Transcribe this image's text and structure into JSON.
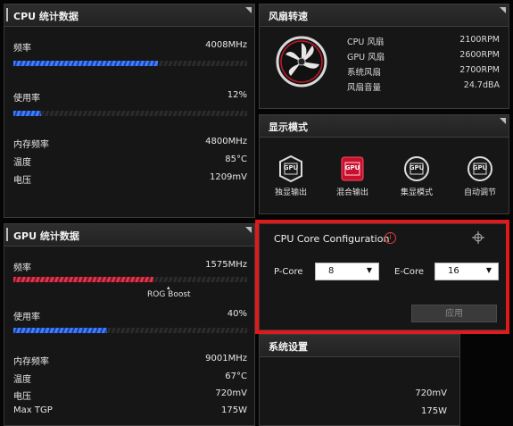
{
  "cpu_stats": {
    "title": "CPU 统计数据",
    "freq_label": "频率",
    "freq_value": "4008MHz",
    "freq_fill": 0.62,
    "usage_label": "使用率",
    "usage_value": "12%",
    "usage_fill": 0.12,
    "mem_freq_label": "内存频率",
    "mem_freq_value": "4800MHz",
    "temp_label": "温度",
    "temp_value": "85°C",
    "voltage_label": "电压",
    "voltage_value": "1209mV"
  },
  "gpu_stats": {
    "title": "GPU 统计数据",
    "freq_label": "频率",
    "freq_value": "1575MHz",
    "freq_fill": 0.6,
    "boost_label": "ROG Boost",
    "usage_label": "使用率",
    "usage_value": "40%",
    "usage_fill": 0.4,
    "mem_freq_label": "内存频率",
    "mem_freq_value": "9001MHz",
    "temp_label": "温度",
    "temp_value": "67°C",
    "voltage_label": "电压",
    "voltage_value": "720mV",
    "tgp_label": "Max TGP",
    "tgp_value": "175W"
  },
  "fan": {
    "title": "风扇转速",
    "rows": [
      {
        "label": "CPU 风扇",
        "value": "2100RPM"
      },
      {
        "label": "GPU 风扇",
        "value": "2600RPM"
      },
      {
        "label": "系统风扇",
        "value": "2700RPM"
      },
      {
        "label": "风扇音量",
        "value": "24.7dBA"
      }
    ]
  },
  "display_mode": {
    "title": "显示模式",
    "icon_text": "GPU",
    "modes": [
      {
        "label": "独显输出",
        "icon": "gpu-dedicated-icon",
        "active": false
      },
      {
        "label": "混合输出",
        "icon": "gpu-hybrid-icon",
        "active": true
      },
      {
        "label": "集显模式",
        "icon": "gpu-integrated-icon",
        "active": false
      },
      {
        "label": "自动调节",
        "icon": "gpu-auto-icon",
        "active": false
      }
    ]
  },
  "cpu_core": {
    "title": "CPU Core Configuration",
    "pcore_label": "P-Core",
    "pcore_value": "8",
    "ecore_label": "E-Core",
    "ecore_value": "16",
    "apply_label": "应用"
  },
  "system_settings": {
    "title": "系统设置",
    "values": [
      "720mV",
      "175W"
    ]
  },
  "colors": {
    "accent_blue": "#3d7dff",
    "accent_red": "#e0344a",
    "highlight_red": "#e01a1a"
  }
}
